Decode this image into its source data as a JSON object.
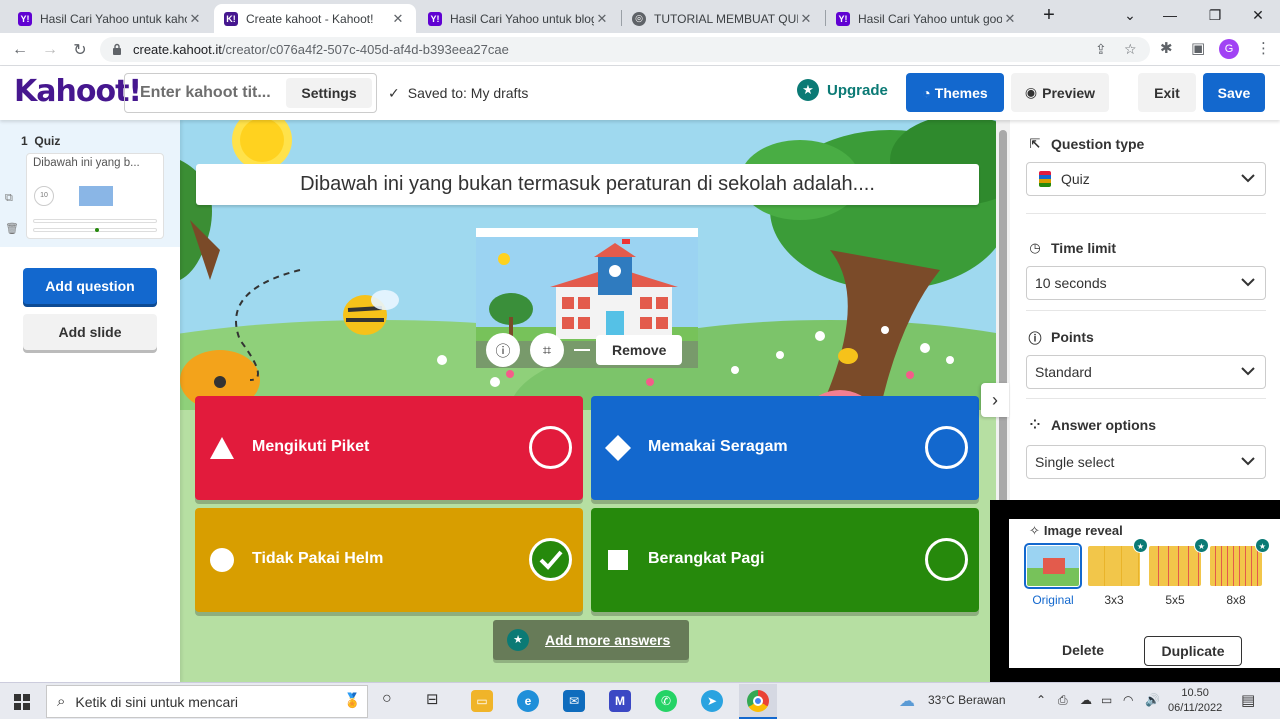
{
  "browser": {
    "tabs": [
      {
        "title": "Hasil Cari Yahoo untuk kaho",
        "favicon": "yahoo-icon",
        "active": false
      },
      {
        "title": "Create kahoot - Kahoot!",
        "favicon": "kahoot-icon",
        "active": true
      },
      {
        "title": "Hasil Cari Yahoo untuk blog",
        "favicon": "yahoo-icon",
        "active": false
      },
      {
        "title": "TUTORIAL MEMBUAT QUIS C",
        "favicon": "globe-icon",
        "active": false
      },
      {
        "title": "Hasil Cari Yahoo untuk goog",
        "favicon": "yahoo-icon",
        "active": false
      }
    ],
    "url_host": "create.kahoot.it",
    "url_path": "/creator/c076a4f2-507c-405d-af4d-b393eea27cae",
    "profile_initial": "G"
  },
  "topbar": {
    "logo": "Kahoot!",
    "title_placeholder": "Enter kahoot tit...",
    "settings_label": "Settings",
    "saved_text": "Saved to: My drafts",
    "upgrade_label": "Upgrade",
    "themes_label": "Themes",
    "preview_label": "Preview",
    "exit_label": "Exit",
    "save_label": "Save"
  },
  "sidebar": {
    "slide_number": "1",
    "slide_type": "Quiz",
    "slide_preview_title": "Dibawah ini yang b...",
    "slide_timer": "10",
    "add_question_label": "Add question",
    "add_slide_label": "Add slide"
  },
  "question": {
    "text": "Dibawah ini yang bukan termasuk peraturan di sekolah adalah....",
    "remove_label": "Remove",
    "answers": [
      {
        "text": "Mengikuti Piket",
        "color": "#e21b3c",
        "shape": "triangle",
        "correct": false
      },
      {
        "text": "Memakai Seragam",
        "color": "#1368ce",
        "shape": "diamond",
        "correct": false
      },
      {
        "text": "Tidak Pakai Helm",
        "color": "#d89e00",
        "shape": "circle",
        "correct": true
      },
      {
        "text": "Berangkat Pagi",
        "color": "#26890c",
        "shape": "square",
        "correct": false
      }
    ],
    "add_more_label": "Add more answers"
  },
  "settings_panel": {
    "question_type_label": "Question type",
    "question_type_value": "Quiz",
    "time_limit_label": "Time limit",
    "time_limit_value": "10 seconds",
    "points_label": "Points",
    "points_value": "Standard",
    "answer_options_label": "Answer options",
    "answer_options_value": "Single select"
  },
  "image_reveal": {
    "title": "Image reveal",
    "options": [
      "Original",
      "3x3",
      "5x5",
      "8x8"
    ],
    "selected": "Original",
    "delete_label": "Delete",
    "duplicate_label": "Duplicate"
  },
  "taskbar": {
    "search_placeholder": "Ketik di sini untuk mencari",
    "weather": "33°C  Berawan",
    "time": "10.50",
    "date": "06/11/2022"
  }
}
